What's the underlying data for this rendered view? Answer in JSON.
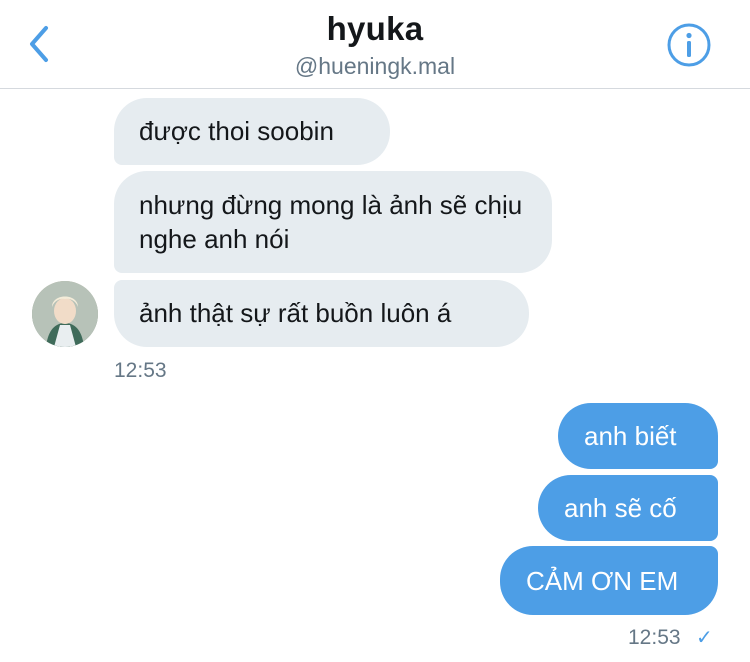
{
  "header": {
    "title": "hyuka",
    "handle": "@hueningk.mal"
  },
  "conversation": {
    "received": [
      {
        "text": "được thoi soobin"
      },
      {
        "text": "nhưng đừng mong là ảnh sẽ chịu nghe anh nói"
      },
      {
        "text": "ảnh thật sự rất buồn luôn á"
      }
    ],
    "received_time": "12:53",
    "sent": [
      {
        "text": "anh biết"
      },
      {
        "text": "anh sẽ cố"
      },
      {
        "text": "CẢM ƠN EM"
      }
    ],
    "sent_time": "12:53",
    "sent_status_icon": "✓"
  },
  "colors": {
    "accent": "#4d9ee6",
    "received_bubble": "#e6ecf0",
    "text_primary": "#14171a",
    "text_secondary": "#657786"
  }
}
